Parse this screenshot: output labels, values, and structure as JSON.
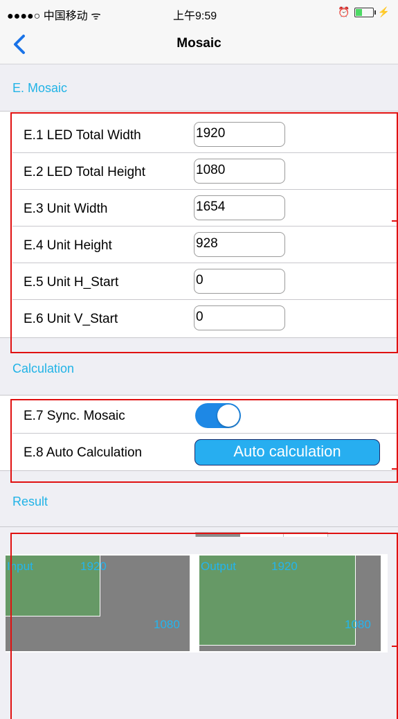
{
  "status_bar": {
    "carrier": "●●●●○ 中国移动 ᯤ",
    "time": "上午9:59",
    "alarm": "⏰",
    "charging": "⚡"
  },
  "nav": {
    "title": "Mosaic",
    "back_icon": "chevron-left-icon"
  },
  "sections": {
    "mosaic": "E. Mosaic",
    "calculation": "Calculation",
    "result": "Result"
  },
  "mosaic_rows": [
    {
      "label": "E.1  LED Total Width",
      "value": "1920"
    },
    {
      "label": "E.2  LED Total Height",
      "value": "1080"
    },
    {
      "label": "E.3  Unit Width",
      "value": "1654"
    },
    {
      "label": "E.4  Unit Height",
      "value": "928"
    },
    {
      "label": "E.5  Unit H_Start",
      "value": "0"
    },
    {
      "label": "E.6  Unit V_Start",
      "value": "0"
    }
  ],
  "calc_rows": {
    "sync_label": "E.7  Sync. Mosaic",
    "sync_on": true,
    "auto_label": "E.8  Auto Calculation",
    "auto_button": "Auto calculation"
  },
  "preview": {
    "input": {
      "title": "Input",
      "width": "1920",
      "height": "1080"
    },
    "output": {
      "title": "Output",
      "width": "1920",
      "height": "1080"
    }
  },
  "colors": {
    "accent": "#21b3e6",
    "switch": "#1e88e5",
    "button": "#27aef0",
    "panel": "#808080",
    "region": "#669966",
    "highlight": "#e01010"
  }
}
